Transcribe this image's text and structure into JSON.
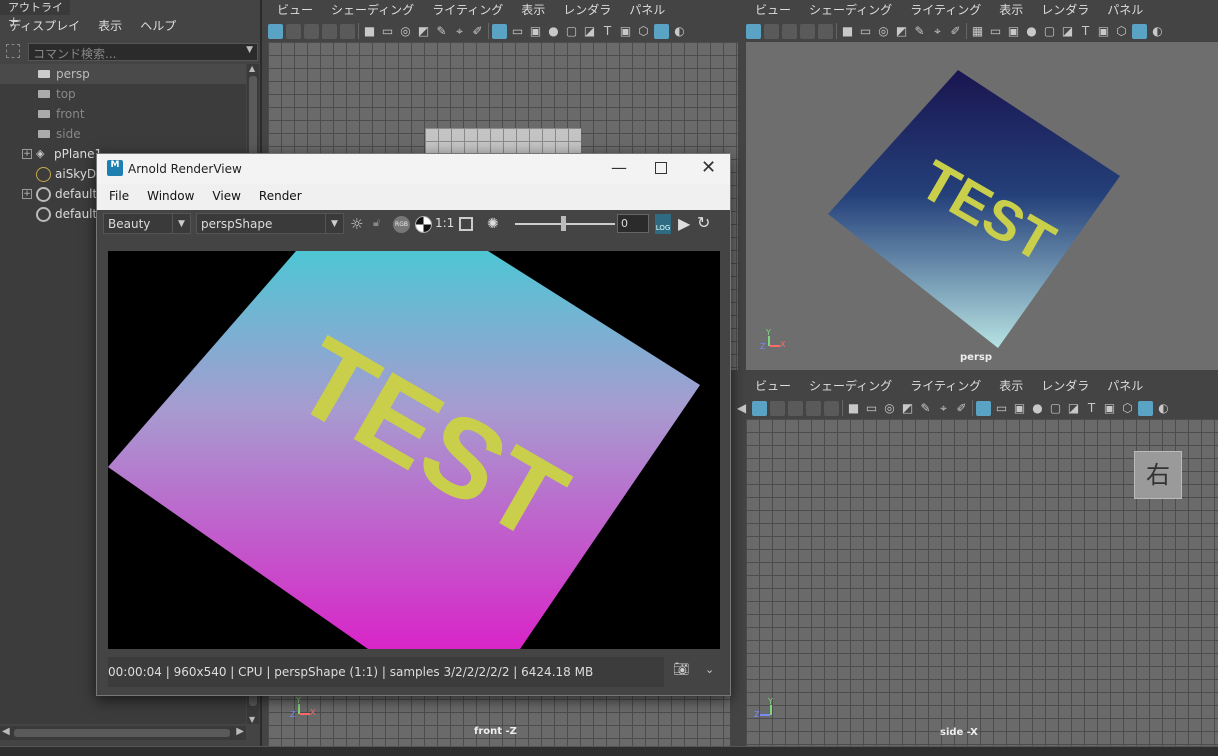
{
  "outliner": {
    "tab_title": "アウトライナ",
    "menu": [
      "ディスプレイ",
      "表示",
      "ヘルプ"
    ],
    "search_placeholder": "コマンド検索...",
    "items": [
      {
        "label": "persp",
        "icon": "camera-icon",
        "expandable": false
      },
      {
        "label": "top",
        "icon": "camera-icon",
        "expandable": false
      },
      {
        "label": "front",
        "icon": "camera-icon",
        "expandable": false
      },
      {
        "label": "side",
        "icon": "camera-icon",
        "expandable": false
      },
      {
        "label": "pPlane1",
        "icon": "mesh-icon",
        "expandable": true
      },
      {
        "label": "aiSkyDo",
        "icon": "sky-dome-icon",
        "expandable": false
      },
      {
        "label": "defaultL",
        "icon": "light-set-icon",
        "expandable": true
      },
      {
        "label": "default",
        "icon": "object-set-icon",
        "expandable": false
      }
    ]
  },
  "viewport_menu": [
    "ビュー",
    "シェーディング",
    "ライティング",
    "表示",
    "レンダラ",
    "パネル"
  ],
  "viewports": {
    "top_left": {
      "label": ""
    },
    "top_right": {
      "label": "persp",
      "text": "TEST"
    },
    "bottom_left": {
      "label": "front -Z"
    },
    "bottom_right": {
      "label": "side -X",
      "overlay": "右"
    }
  },
  "render_view": {
    "title": "Arnold RenderView",
    "app_icon_letter": "M",
    "menu": [
      "File",
      "Window",
      "View",
      "Render"
    ],
    "aov_value": "Beauty",
    "camera_value": "perspShape",
    "ratio_label": "1:1",
    "exposure_value": "0",
    "rgb_label": "RGB",
    "log_label": "LOG",
    "image_text": "TEST",
    "status": "00:00:04 | 960x540 | CPU | perspShape (1:1) | samples 3/2/2/2/2/2 | 6424.18 MB"
  },
  "axis_labels": {
    "x": "X",
    "y": "Y",
    "z": "Z"
  },
  "colors": {
    "accent": "#5ba3c4",
    "grid": "#6a6a6a",
    "test_text": "#c9cf4a"
  }
}
